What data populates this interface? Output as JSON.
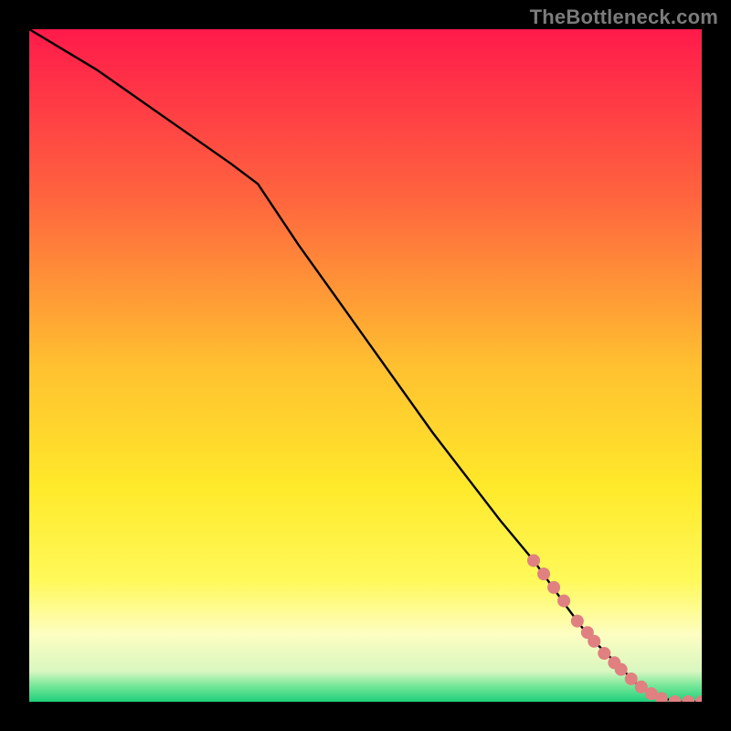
{
  "watermark": "TheBottleneck.com",
  "colors": {
    "black": "#000000",
    "line": "#000000",
    "marker": "#e08080"
  },
  "chart_data": {
    "type": "line",
    "xlim": [
      0,
      100
    ],
    "ylim": [
      0,
      100
    ],
    "xlabel": "",
    "ylabel": "",
    "title": "",
    "background_gradient": {
      "stops": [
        {
          "pos": 0.0,
          "color": "#ff1a4b"
        },
        {
          "pos": 0.25,
          "color": "#ff643e"
        },
        {
          "pos": 0.5,
          "color": "#ffc030"
        },
        {
          "pos": 0.68,
          "color": "#ffe92a"
        },
        {
          "pos": 0.82,
          "color": "#fff95a"
        },
        {
          "pos": 0.9,
          "color": "#fdfec1"
        },
        {
          "pos": 0.955,
          "color": "#d8f7c0"
        },
        {
          "pos": 0.975,
          "color": "#7be89a"
        },
        {
          "pos": 1.0,
          "color": "#1fd07a"
        }
      ]
    },
    "series": [
      {
        "name": "curve",
        "x": [
          0,
          10,
          20,
          30,
          34,
          40,
          50,
          60,
          70,
          75,
          80,
          83,
          85,
          87,
          89,
          91,
          93,
          96,
          100
        ],
        "y": [
          100,
          94,
          87,
          80,
          77,
          68,
          54,
          40,
          27,
          21,
          14,
          10,
          8,
          6,
          4,
          2,
          1,
          0,
          0
        ]
      }
    ],
    "markers": [
      {
        "x": 75.0,
        "y": 21.0
      },
      {
        "x": 76.5,
        "y": 19.0
      },
      {
        "x": 78.0,
        "y": 17.0
      },
      {
        "x": 79.5,
        "y": 15.0
      },
      {
        "x": 81.5,
        "y": 12.0
      },
      {
        "x": 83.0,
        "y": 10.3
      },
      {
        "x": 84.0,
        "y": 9.0
      },
      {
        "x": 85.5,
        "y": 7.2
      },
      {
        "x": 87.0,
        "y": 5.8
      },
      {
        "x": 88.0,
        "y": 4.8
      },
      {
        "x": 89.5,
        "y": 3.4
      },
      {
        "x": 91.0,
        "y": 2.2
      },
      {
        "x": 92.5,
        "y": 1.2
      },
      {
        "x": 94.0,
        "y": 0.5
      },
      {
        "x": 96.0,
        "y": 0.0
      },
      {
        "x": 98.0,
        "y": 0.0
      },
      {
        "x": 100.0,
        "y": 0.0
      }
    ]
  }
}
